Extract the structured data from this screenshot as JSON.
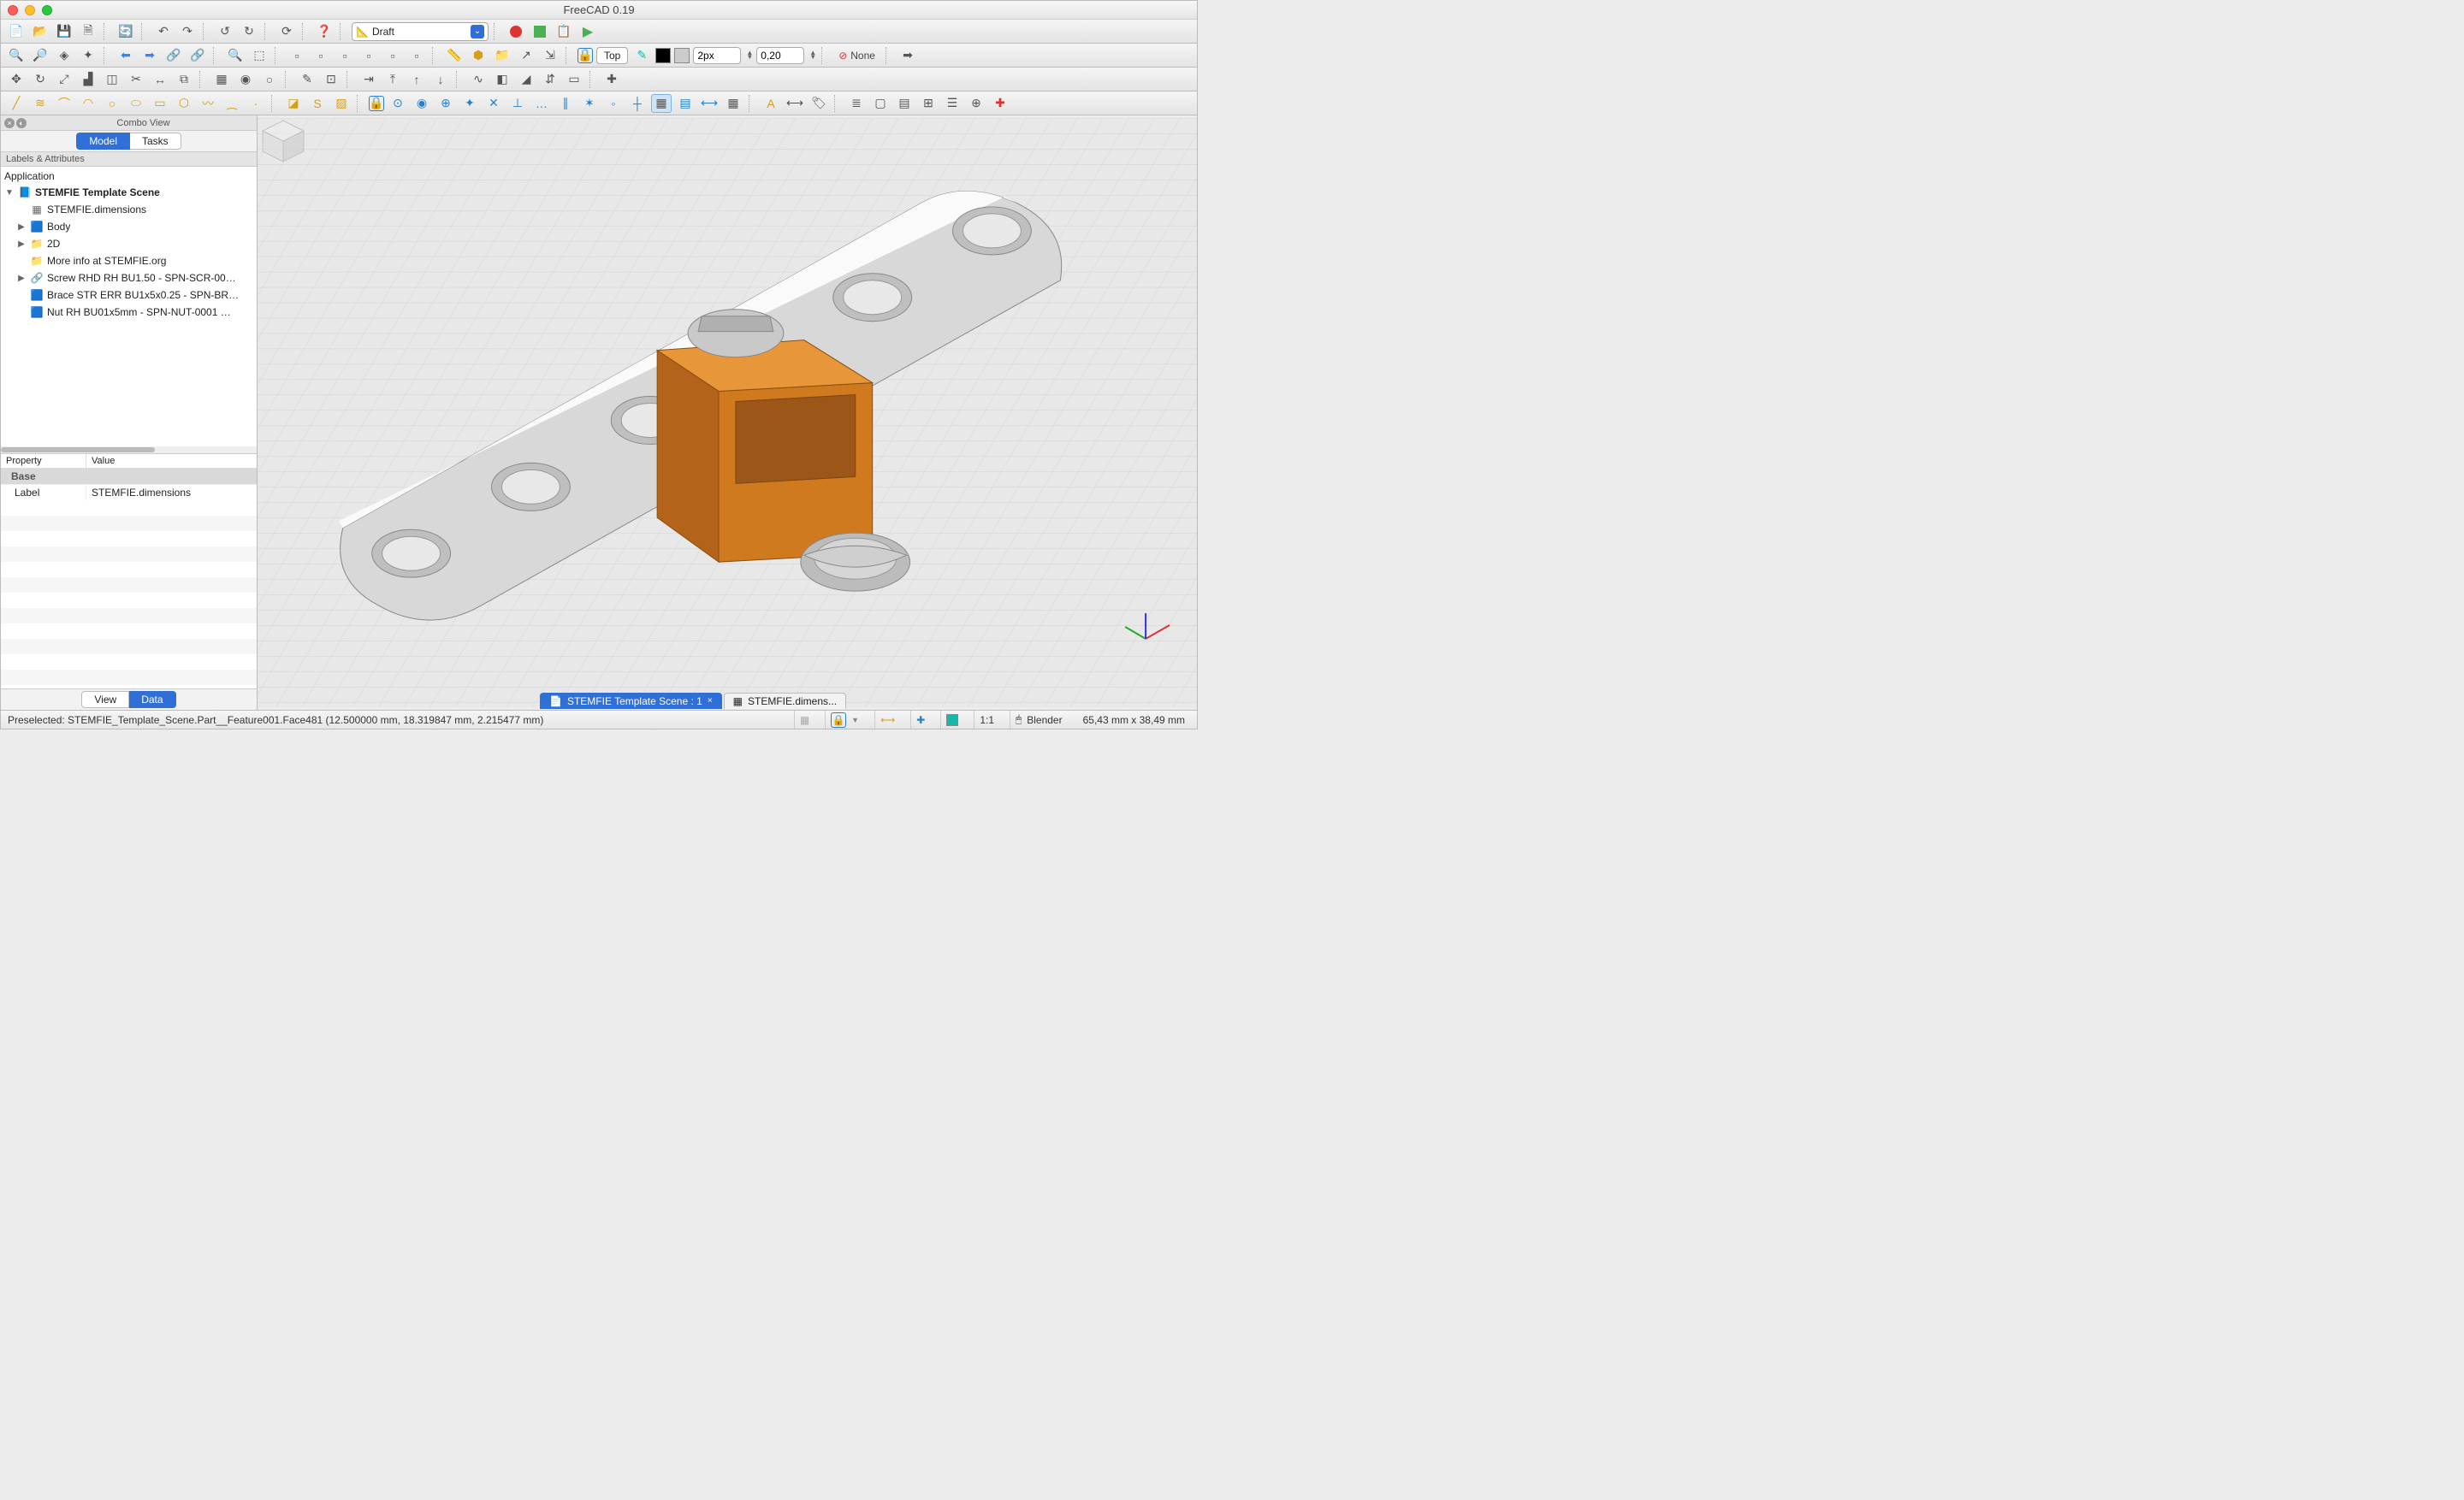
{
  "window_title": "FreeCAD 0.19",
  "workbench_selector": "Draft",
  "toolbar2": {
    "view_label": "Top",
    "px_value": "2px",
    "opacity_value": "0,20",
    "none_label": "None"
  },
  "combo_view": {
    "title": "Combo View",
    "tab_model": "Model",
    "tab_tasks": "Tasks",
    "labels_attr": "Labels & Attributes",
    "app_label": "Application"
  },
  "tree": [
    {
      "depth": 0,
      "toggle": "▼",
      "icon": "doc",
      "label": "STEMFIE Template Scene",
      "bold": true
    },
    {
      "depth": 1,
      "toggle": "",
      "icon": "sheet",
      "label": "STEMFIE.dimensions"
    },
    {
      "depth": 1,
      "toggle": "▶",
      "icon": "cube",
      "label": "Body"
    },
    {
      "depth": 1,
      "toggle": "▶",
      "icon": "folder",
      "label": "2D"
    },
    {
      "depth": 1,
      "toggle": "",
      "icon": "folder",
      "label": "More info at STEMFIE.org"
    },
    {
      "depth": 1,
      "toggle": "▶",
      "icon": "link",
      "label": "Screw RHD RH BU1.50 - SPN-SCR-00…"
    },
    {
      "depth": 1,
      "toggle": "",
      "icon": "part",
      "label": "Brace STR ERR BU1x5x0.25 - SPN-BR…"
    },
    {
      "depth": 1,
      "toggle": "",
      "icon": "part",
      "label": "Nut RH BU01x5mm - SPN-NUT-0001 …"
    }
  ],
  "property": {
    "col_property": "Property",
    "col_value": "Value",
    "group_base": "Base",
    "row_label_key": "Label",
    "row_label_val": "STEMFIE.dimensions",
    "tab_view": "View",
    "tab_data": "Data"
  },
  "doc_tabs": {
    "tab1": "STEMFIE Template Scene : 1",
    "tab2": "STEMFIE.dimens..."
  },
  "statusbar": {
    "preselected": "Preselected: STEMFIE_Template_Scene.Part__Feature001.Face481 (12.500000 mm, 18.319847 mm, 2.215477 mm)",
    "zoom": "1:1",
    "nav_style": "Blender",
    "dimensions": "65,43 mm x 38,49 mm"
  }
}
